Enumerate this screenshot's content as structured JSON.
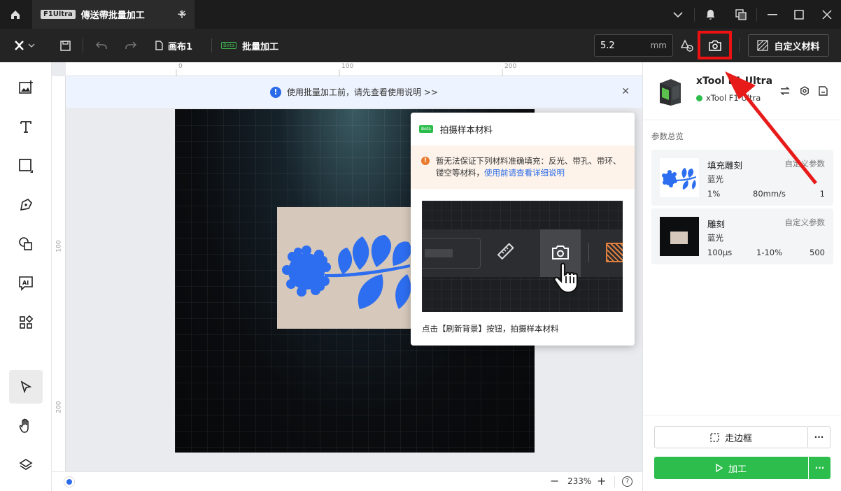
{
  "titlebar": {
    "tab_badge": "F1Ultra",
    "tab_title": "傳送帶批量加工"
  },
  "toolbar": {
    "canvas_name": "画布1",
    "beta": "Beta",
    "batch_label": "批量加工",
    "size_value": "5.2",
    "size_unit": "mm",
    "material_button": "自定义材料"
  },
  "canvas": {
    "ruler_h": [
      "0",
      "100",
      "200"
    ],
    "ruler_v": [
      "100",
      "200"
    ],
    "banner_text": "使用批量加工前，请先查看使用说明 >>",
    "zoom": "233%"
  },
  "popup": {
    "beta": "Beta",
    "title": "拍摄样本材料",
    "warning_text": "暂无法保证下列材料准确填充：反光、带孔、带环、镂空等材料，",
    "warning_link": "使用前请查看详细说明",
    "caption": "点击【刷新背景】按钮，拍摄样本材料"
  },
  "device": {
    "name": "xTool F1 Ultra",
    "status": "xTool F1 Ultra"
  },
  "params": {
    "section_title": "参数总览",
    "layers": [
      {
        "name": "填充雕刻",
        "tag": "自定义参数",
        "laser": "蓝光",
        "p1": "1%",
        "p2": "80mm/s",
        "p3": "1"
      },
      {
        "name": "雕刻",
        "tag": "自定义参数",
        "laser": "蓝光",
        "p1": "100μs",
        "p2": "1-10%",
        "p3": "500"
      }
    ]
  },
  "actions": {
    "frame": "走边框",
    "process": "加工",
    "more": "···"
  },
  "colors": {
    "accent_green": "#2dbd4d",
    "highlight_red": "#e11111",
    "link_blue": "#2c6be8"
  }
}
